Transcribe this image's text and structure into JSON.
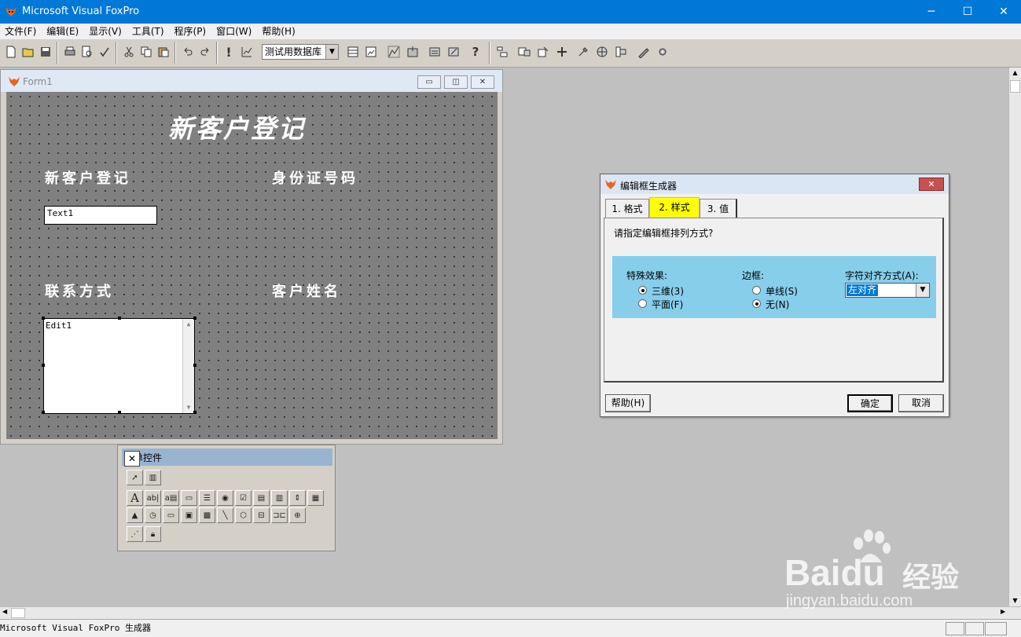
{
  "app": {
    "title": "Microsoft Visual FoxPro"
  },
  "menu": [
    "文件(F)",
    "编辑(E)",
    "显示(V)",
    "工具(T)",
    "程序(P)",
    "窗口(W)",
    "帮助(H)"
  ],
  "toolbar": {
    "database_combo": "测试用数据库"
  },
  "form": {
    "title": "Form1",
    "heading": "新客户登记",
    "label1": "新客户登记",
    "label2": "身份证号码",
    "label3": "联系方式",
    "label4": "客户姓名",
    "textbox": "Text1",
    "editbox": "Edit1"
  },
  "palette": {
    "title": "表单控件"
  },
  "dialog": {
    "title": "编辑框生成器",
    "tabs": [
      "1. 格式",
      "2. 样式",
      "3. 值"
    ],
    "prompt": "请指定编辑框排列方式?",
    "effects_label": "特殊效果:",
    "effect_options": [
      "三维(3)",
      "平面(F)"
    ],
    "border_label": "边框:",
    "border_options": [
      "单线(S)",
      "无(N)"
    ],
    "align_label": "字符对齐方式(A):",
    "align_value": "左对齐",
    "help_button": "帮助(H)",
    "ok_button": "确定",
    "cancel_button": "取消"
  },
  "status": {
    "text": "Microsoft Visual FoxPro 生成器"
  },
  "watermark": {
    "brand": "Baidu",
    "brand_cn": "经验",
    "url": "jingyan.baidu.com"
  },
  "colors": {
    "title_bar": "#0078d7",
    "highlight_tab": "#ffff00",
    "options_bg": "#87ceeb",
    "form_canvas": "#808080"
  }
}
